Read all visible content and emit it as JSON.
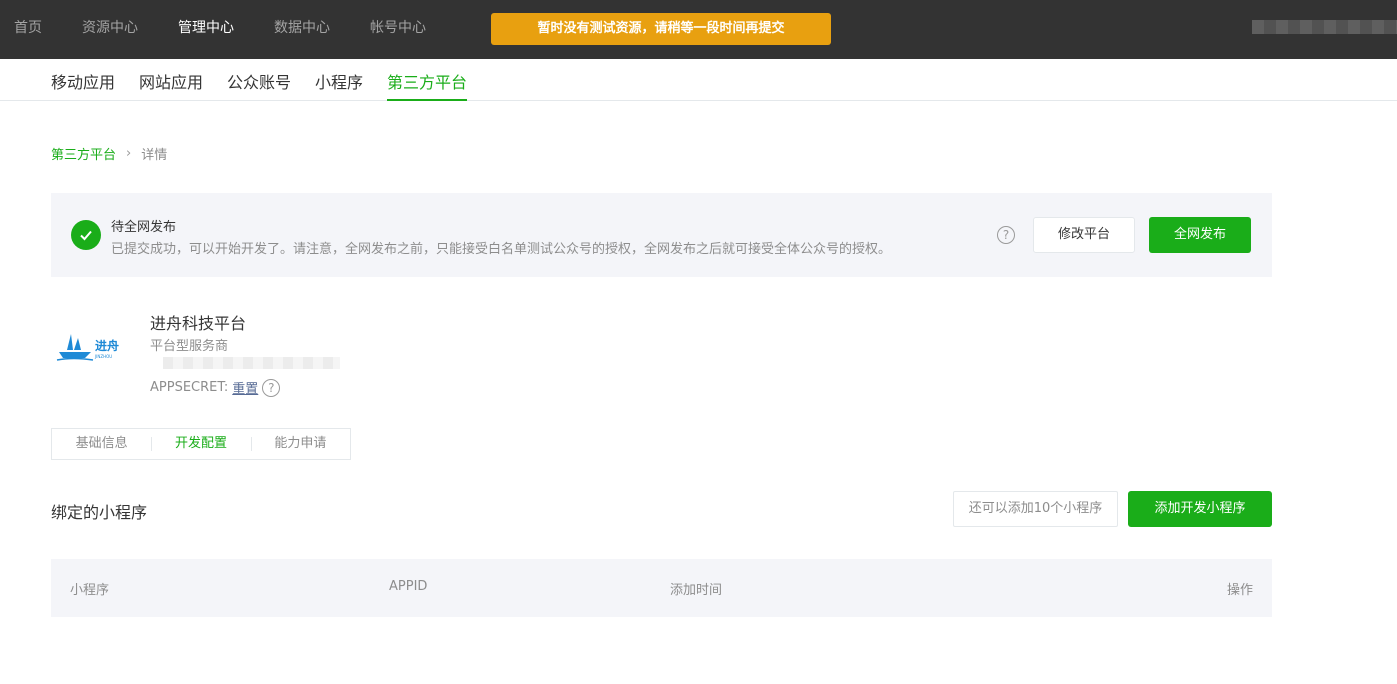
{
  "topnav": {
    "items": [
      "首页",
      "资源中心",
      "管理中心",
      "数据中心",
      "帐号中心"
    ],
    "active_index": 2
  },
  "notice": "暂时没有测试资源，请稍等一段时间再提交",
  "subnav": {
    "items": [
      "移动应用",
      "网站应用",
      "公众账号",
      "小程序",
      "第三方平台"
    ],
    "active_index": 4
  },
  "breadcrumb": {
    "parent": "第三方平台",
    "current": "详情"
  },
  "status": {
    "title": "待全网发布",
    "description": "已提交成功，可以开始开发了。请注意，全网发布之前，只能接受白名单测试公众号的授权，全网发布之后就可接受全体公众号的授权。",
    "help": "?",
    "modify_button": "修改平台",
    "publish_button": "全网发布"
  },
  "platform": {
    "logo_text": "进舟",
    "logo_subtext": "JINZHOU",
    "name": "进舟科技平台",
    "type": "平台型服务商",
    "secret_label": "APPSECRET:",
    "reset_link": "重置",
    "help": "?"
  },
  "tabs": {
    "items": [
      "基础信息",
      "开发配置",
      "能力申请"
    ],
    "active_index": 1
  },
  "miniprograms": {
    "title": "绑定的小程序",
    "quota": "还可以添加10个小程序",
    "add_button": "添加开发小程序",
    "columns": [
      "小程序",
      "APPID",
      "添加时间",
      "操作"
    ]
  },
  "colors": {
    "brand_green": "#1aad19",
    "notice_orange": "#e8a010",
    "topbar": "#333333",
    "panel_bg": "#f4f5f9",
    "logo_blue": "#1f8ad6"
  }
}
